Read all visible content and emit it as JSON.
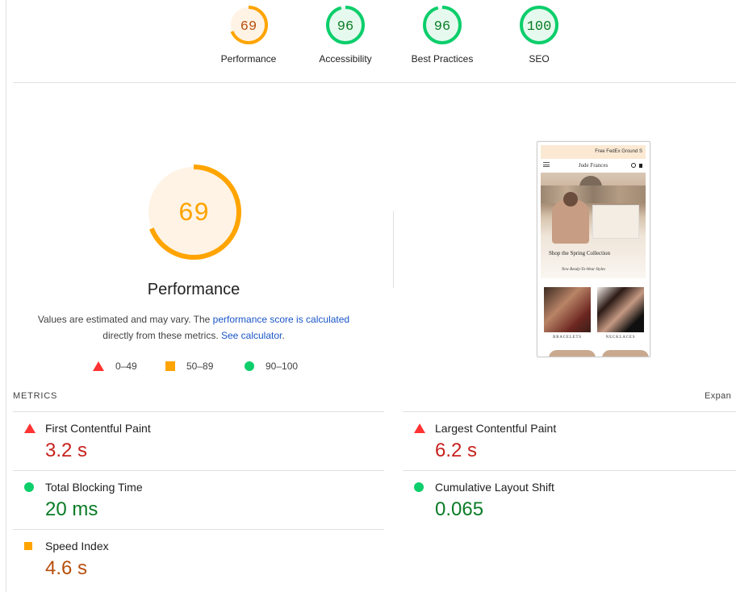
{
  "colors": {
    "fail": "#ff3333",
    "fail_text": "#c7221f",
    "average": "#ffa400",
    "average_text": "#b84e0c",
    "average_fill": "#fff3e5",
    "pass": "#0cce6b",
    "pass_text": "#0a7c26",
    "pass_fill": "#e6f9ee",
    "link": "#1a56c8"
  },
  "categories": [
    {
      "score": "69",
      "score_value": 0.69,
      "label": "Performance",
      "rating": "average"
    },
    {
      "score": "96",
      "score_value": 0.96,
      "label": "Accessibility",
      "rating": "pass"
    },
    {
      "score": "96",
      "score_value": 0.96,
      "label": "Best Practices",
      "rating": "pass"
    },
    {
      "score": "100",
      "score_value": 1.0,
      "label": "SEO",
      "rating": "pass"
    }
  ],
  "performance": {
    "score": "69",
    "score_value": 0.69,
    "title": "Performance",
    "desc_pre": "Values are estimated and may vary. The ",
    "desc_link": "performance score is calculated",
    "desc_mid": " directly from these metrics. ",
    "desc_link2": "See calculator",
    "desc_post": "."
  },
  "legend": [
    {
      "icon": "triangle-icon",
      "range": "0–49"
    },
    {
      "icon": "square-icon",
      "range": "50–89"
    },
    {
      "icon": "circle-icon",
      "range": "90–100"
    }
  ],
  "screenshot": {
    "banner": "Free FedEx Ground S",
    "brand": "Jude Frances",
    "hero_title": "Shop the Spring Collection",
    "hero_sub": "New Ready-To-Wear Styles",
    "tiles": [
      "BRACELETS",
      "NECKLACES"
    ]
  },
  "metrics_header": "METRICS",
  "expand_label": "Expan",
  "metrics": [
    {
      "name": "First Contentful Paint",
      "value": "3.2 s",
      "rating": "fail"
    },
    {
      "name": "Largest Contentful Paint",
      "value": "6.2 s",
      "rating": "fail"
    },
    {
      "name": "Total Blocking Time",
      "value": "20 ms",
      "rating": "pass"
    },
    {
      "name": "Cumulative Layout Shift",
      "value": "0.065",
      "rating": "pass"
    },
    {
      "name": "Speed Index",
      "value": "4.6 s",
      "rating": "average"
    }
  ]
}
